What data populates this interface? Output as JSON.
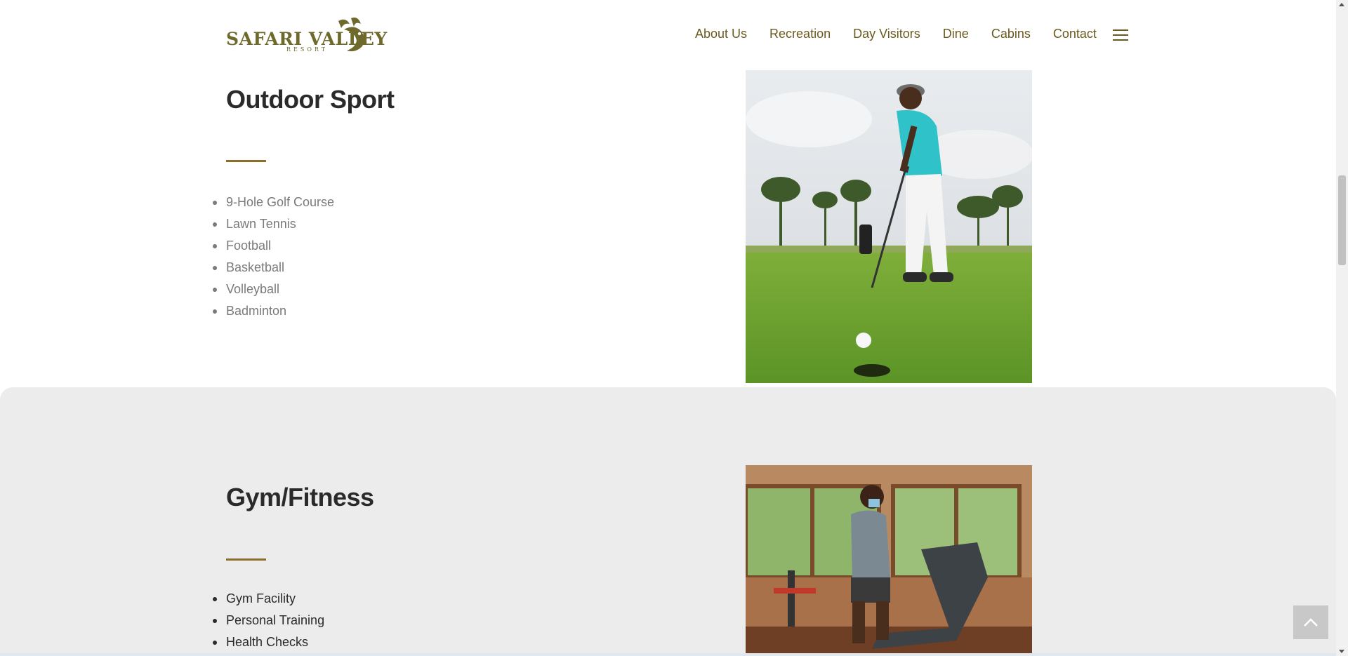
{
  "brand": {
    "name": "SAFARI VALLEY",
    "tagline": "RESORT",
    "color": "#6e6a2c"
  },
  "nav": {
    "items": [
      "About Us",
      "Recreation",
      "Day Visitors",
      "Dine",
      "Cabins",
      "Contact"
    ],
    "menu_icon": "hamburger-menu-icon",
    "color": "#6b5a1f"
  },
  "sections": [
    {
      "title": "Outdoor Sport",
      "items": [
        "9-Hole Golf Course",
        "Lawn Tennis",
        "Football",
        "Basketball",
        "Volleyball",
        "Badminton"
      ],
      "image": "golfer-putting-on-green-photo"
    },
    {
      "title": "Gym/Fitness",
      "items": [
        "Gym Facility",
        "Personal Training",
        "Health Checks"
      ],
      "image": "man-on-treadmill-photo"
    }
  ],
  "accent_color": "#8c6d2a",
  "back_to_top_icon": "chevron-up-icon"
}
